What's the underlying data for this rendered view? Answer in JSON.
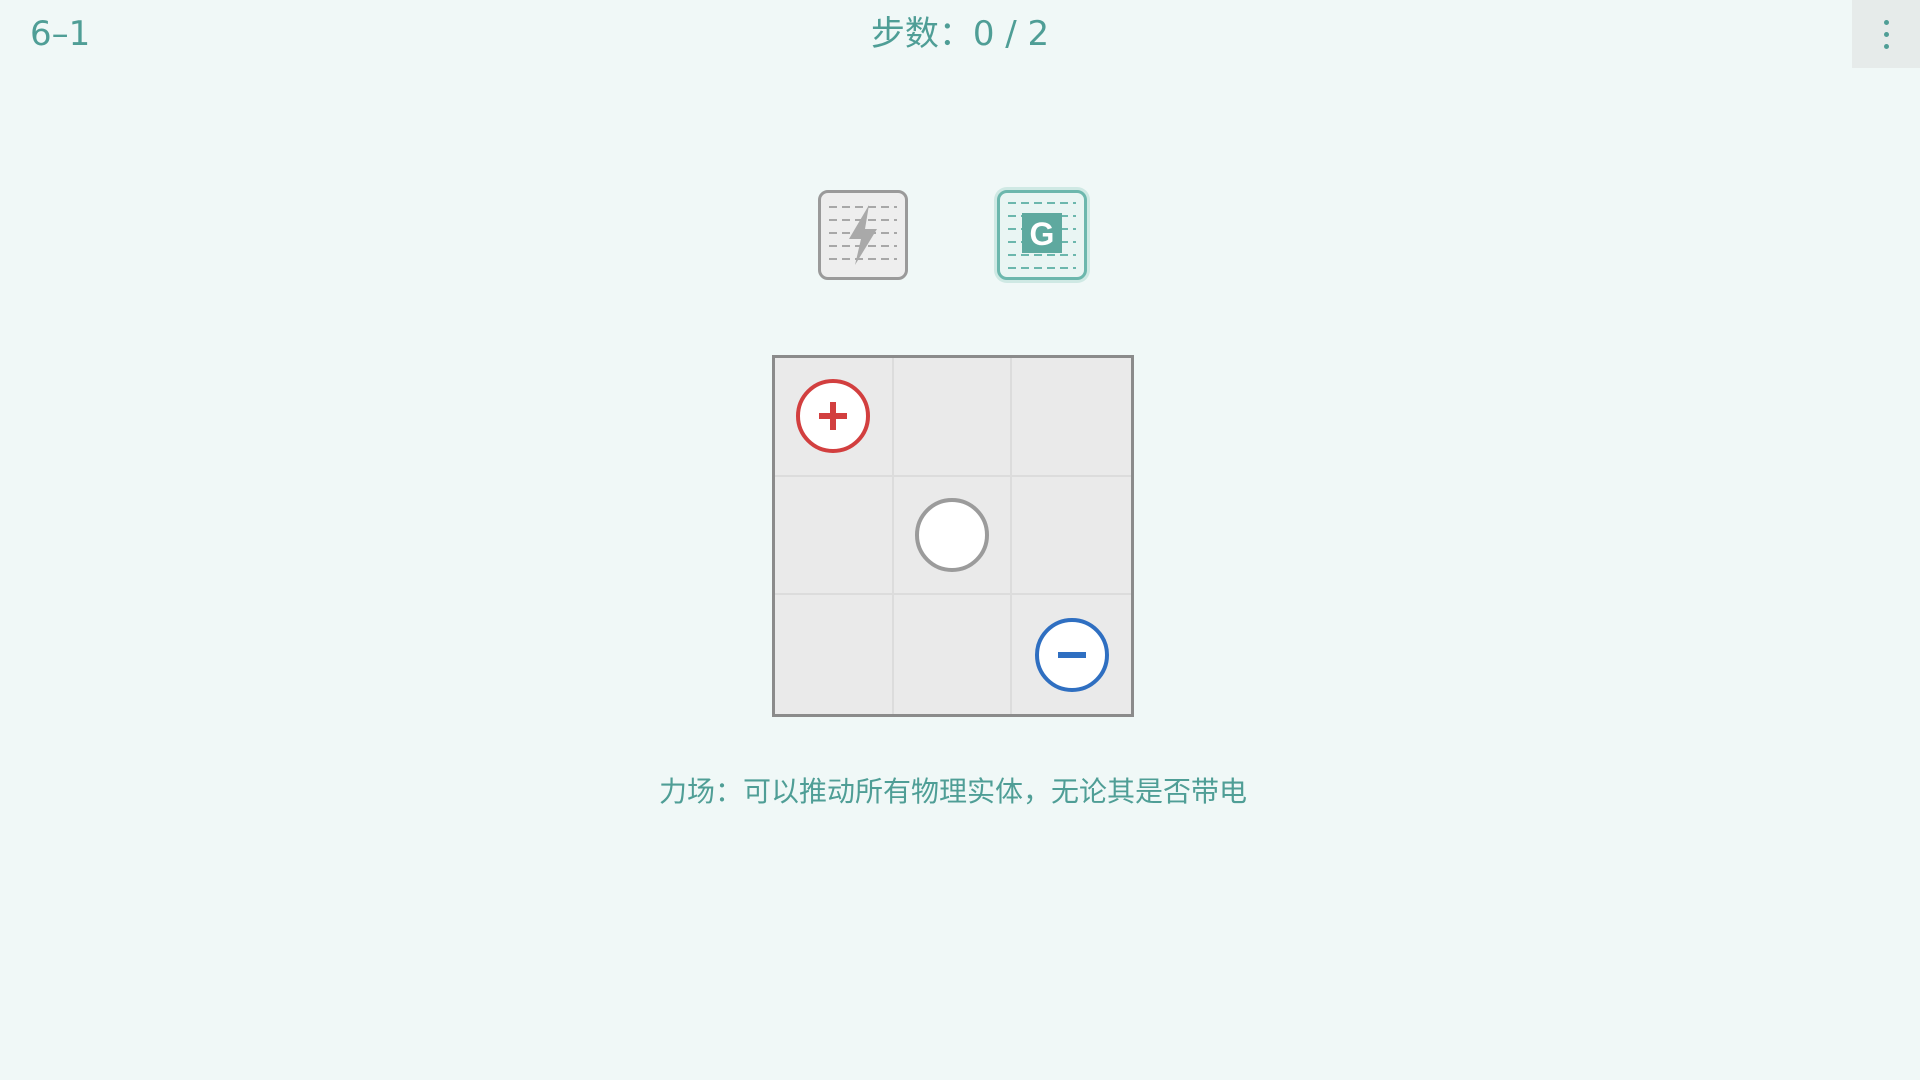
{
  "header": {
    "level": "6–1",
    "steps_label": "步数：0 / 2",
    "menu_icon": "more-vertical-icon"
  },
  "toolbar": {
    "tools": [
      {
        "name": "lightning",
        "icon": "lightning-icon",
        "selected": false
      },
      {
        "name": "force-field",
        "icon": "force-field-icon",
        "letter": "G",
        "selected": true
      }
    ]
  },
  "board": {
    "rows": 3,
    "cols": 3,
    "pieces": [
      {
        "row": 0,
        "col": 0,
        "type": "positive",
        "symbol": "+"
      },
      {
        "row": 1,
        "col": 1,
        "type": "neutral",
        "symbol": ""
      },
      {
        "row": 2,
        "col": 2,
        "type": "negative",
        "symbol": "−"
      }
    ]
  },
  "description": "力场：可以推动所有物理实体，无论其是否带电",
  "colors": {
    "accent": "#4f9e96",
    "positive": "#d23f3f",
    "negative": "#2f6fc1",
    "neutral": "#9b9b9b",
    "background": "#f0f8f7"
  }
}
